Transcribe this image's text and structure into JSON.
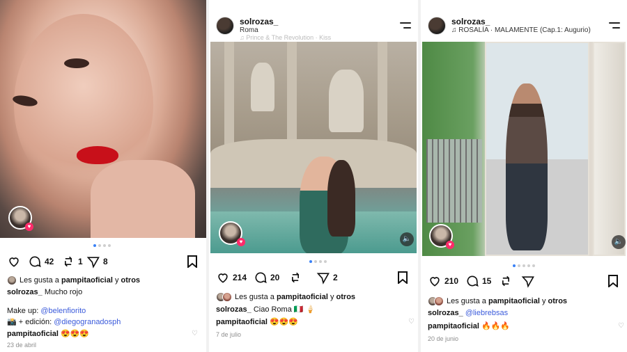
{
  "posts": [
    {
      "carousel": {
        "count": 4,
        "active": 0
      },
      "actions": {
        "likes": "",
        "comments": "42",
        "reposts": "1",
        "shares": "8"
      },
      "likes_line": {
        "prefix": "Les gusta a",
        "user": "pampitaoficial",
        "joiner": "y",
        "others": "otros"
      },
      "caption_user": "solrozas_",
      "caption_text": "Mucho rojo",
      "credits": [
        {
          "label": "Make up:",
          "handle": "@belenfiorito"
        },
        {
          "label": "📸 + edición:",
          "handle": "@diegogranadosph"
        }
      ],
      "comment": {
        "user": "pampitaoficial",
        "text": "😍😍😍"
      },
      "date": "23 de abril"
    },
    {
      "header": {
        "username": "solrozas_",
        "subtitle": "Roma",
        "music": "♫ Prince & The Revolution · Kiss"
      },
      "carousel": {
        "count": 4,
        "active": 0
      },
      "actions": {
        "likes": "214",
        "comments": "20",
        "reposts": "",
        "shares": "2"
      },
      "likes_line": {
        "prefix": "Les gusta a",
        "user": "pampitaoficial",
        "joiner": "y",
        "others": "otros"
      },
      "caption_user": "solrozas_",
      "caption_text": "Ciao Roma 🇮🇹 🍦",
      "comment": {
        "user": "pampitaoficial",
        "text": "😍😍😍"
      },
      "date": "7 de julio"
    },
    {
      "header": {
        "username": "solrozas_",
        "subtitle": "♫ ROSALÍA · MALAMENTE (Cap.1: Augurio)"
      },
      "carousel": {
        "count": 5,
        "active": 0
      },
      "actions": {
        "likes": "210",
        "comments": "15",
        "reposts": "",
        "shares": ""
      },
      "likes_line": {
        "prefix": "Les gusta a",
        "user": "pampitaoficial",
        "joiner": "y",
        "others": "otros"
      },
      "caption_user": "solrozas_",
      "caption_text": "@liebrebsas",
      "comment": {
        "user": "pampitaoficial",
        "text": "🔥🔥🔥"
      },
      "date": "20 de junio"
    }
  ],
  "icons": {
    "heart": "heart-icon",
    "comment": "comment-icon",
    "repost": "repost-icon",
    "share": "share-icon",
    "bookmark": "bookmark-icon",
    "menu": "menu-icon",
    "sound": "sound-icon",
    "like_small": "heart-outline-icon"
  },
  "colors": {
    "accent_dot": "#3b82f6",
    "link": "#3b5bdb",
    "heart_badge": "#ff2b6a",
    "date": "#8e8e8e"
  }
}
